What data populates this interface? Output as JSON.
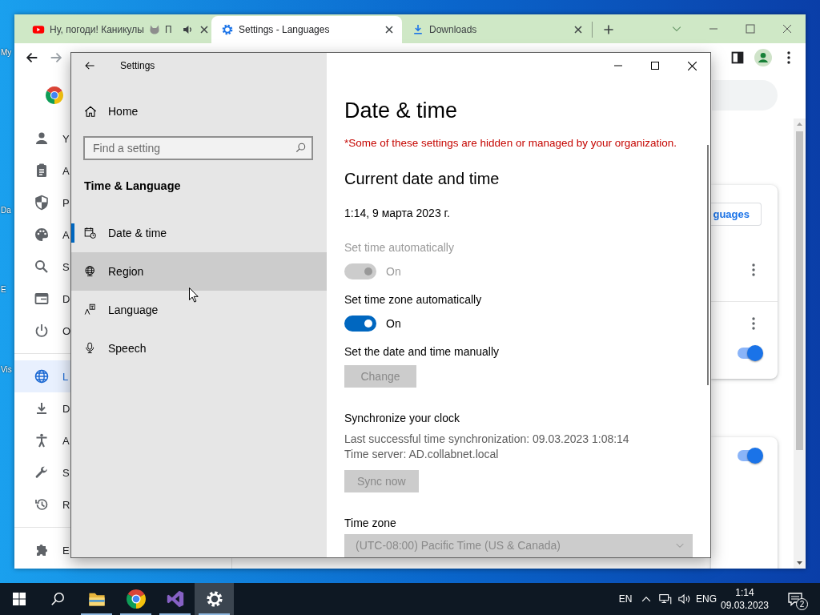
{
  "desktop": {
    "icons": [
      {
        "label": "My"
      },
      {
        "label": "Da"
      },
      {
        "label": "E"
      },
      {
        "label": "Vis"
      }
    ]
  },
  "browser": {
    "tabs": [
      {
        "kind": "video",
        "title": "Ну, погоди! Каникулы",
        "title_tail": "П",
        "audio": true,
        "selected": false
      },
      {
        "kind": "settings",
        "title": "Settings - Languages",
        "selected": true
      },
      {
        "kind": "download",
        "title": "Downloads",
        "selected": false
      }
    ],
    "sidebar": [
      {
        "kind": "person",
        "label": "Y",
        "selected": false
      },
      {
        "kind": "autofill",
        "label": "A",
        "selected": false
      },
      {
        "kind": "privacy",
        "label": "P",
        "selected": false
      },
      {
        "kind": "appearance",
        "label": "A",
        "selected": false
      },
      {
        "kind": "search",
        "label": "S",
        "selected": false
      },
      {
        "kind": "browser",
        "label": "D",
        "selected": false
      },
      {
        "kind": "startup",
        "label": "O",
        "selected": false
      },
      {
        "kind": "languages",
        "label": "L",
        "selected": true
      },
      {
        "kind": "downloads",
        "label": "D",
        "selected": false
      },
      {
        "kind": "accessibility",
        "label": "A",
        "selected": false
      },
      {
        "kind": "system",
        "label": "S",
        "selected": false
      },
      {
        "kind": "reset",
        "label": "R",
        "selected": false
      },
      {
        "kind": "extensions",
        "label": "E",
        "selected": false
      }
    ],
    "cards": [
      {
        "button": "guages",
        "toggle_on": true
      },
      {
        "toggle_on": true
      }
    ]
  },
  "settings_window": {
    "title": "Settings",
    "home": "Home",
    "search": {
      "placeholder": "Find a setting"
    },
    "section": "Time & Language",
    "nav": [
      {
        "kind": "date_time",
        "label": "Date & time",
        "selected": true,
        "hovered": false
      },
      {
        "kind": "region",
        "label": "Region",
        "selected": false,
        "hovered": true
      },
      {
        "kind": "language",
        "label": "Language",
        "selected": false,
        "hovered": false
      },
      {
        "kind": "speech",
        "label": "Speech",
        "selected": false,
        "hovered": false
      }
    ],
    "page": {
      "title": "Date & time",
      "notice": "*Some of these settings are hidden or managed by your organization.",
      "heading": "Current date and time",
      "current_time": "1:14, 9 марта 2023 г.",
      "items": [
        {
          "kind": "toggle",
          "label": "Set time automatically",
          "state_text": "On",
          "on": true,
          "disabled": true
        },
        {
          "kind": "toggle",
          "label": "Set time zone automatically",
          "state_text": "On",
          "on": true,
          "disabled": false
        },
        {
          "kind": "button",
          "label": "Set the date and time manually",
          "button": "Change",
          "disabled": true
        },
        {
          "kind": "sync",
          "label": "Synchronize your clock",
          "lines": [
            "Last successful time synchronization: 09.03.2023 1:08:14",
            "Time server: AD.collabnet.local"
          ],
          "button": "Sync now",
          "disabled": true
        },
        {
          "kind": "dropdown",
          "label": "Time zone",
          "value": "(UTC-08:00) Pacific Time (US & Canada)",
          "disabled": true
        }
      ]
    }
  },
  "taskbar": {
    "apps": [
      {
        "kind": "explorer",
        "open": true,
        "active": false
      },
      {
        "kind": "chrome",
        "open": true,
        "active": false
      },
      {
        "kind": "visual_studio",
        "open": true,
        "active": false
      },
      {
        "kind": "settings",
        "open": true,
        "active": true
      }
    ],
    "input_method": "EN",
    "language": "ENG",
    "time": "1:14",
    "date": "09.03.2023",
    "notifications": "2"
  }
}
